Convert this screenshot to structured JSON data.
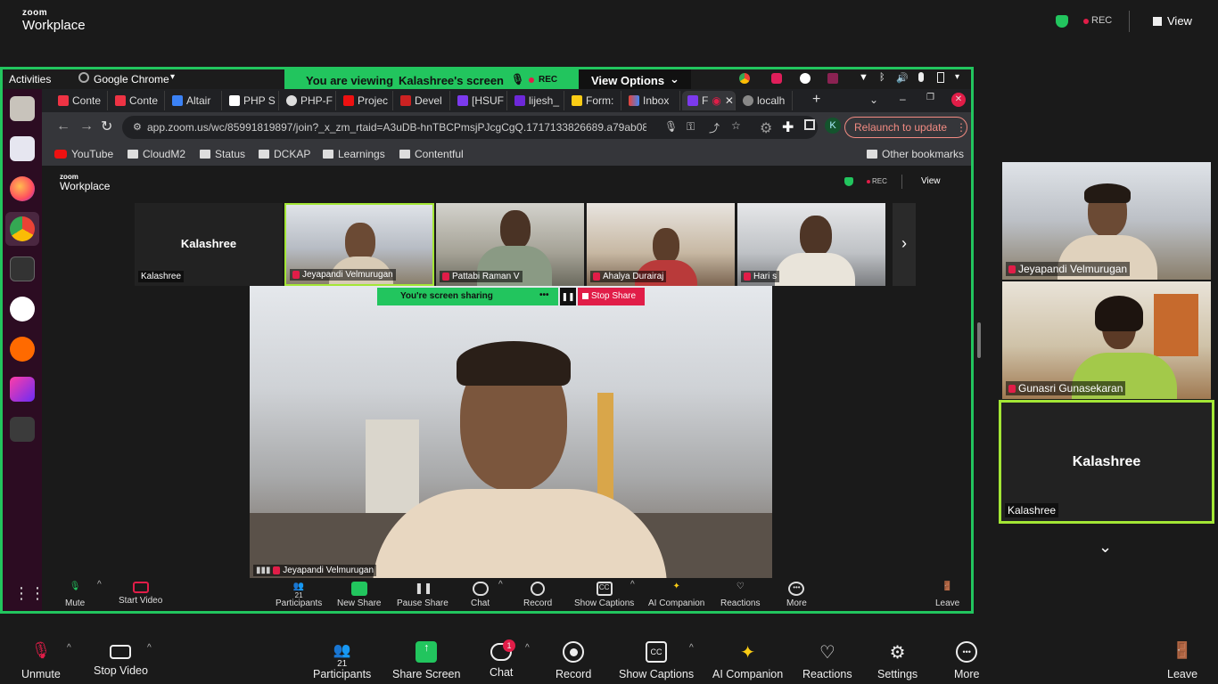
{
  "app": {
    "brand_small": "zoom",
    "brand_large": "Workplace",
    "rec_label": "REC",
    "view_label": "View"
  },
  "ubuntu": {
    "activities": "Activities",
    "app_name": "Google Chrome"
  },
  "banner": {
    "viewing_prefix": "You are viewing",
    "viewing_name": "Kalashree's screen",
    "rec": "REC",
    "view_options": "View Options"
  },
  "chrome": {
    "tabs": [
      "Conte",
      "Conte",
      "Altair",
      "PHP S",
      "PHP-F",
      "Projec",
      "Devel",
      "[HSUF",
      "lijesh_",
      "Form:",
      "Inbox",
      "F",
      "localh"
    ],
    "url": "app.zoom.us/wc/85991819897/join?_x_zm_rtaid=A3uDB-hnTBCPmsjPJcgCgQ.1717133826689.a79ab08478bd...",
    "relaunch": "Relaunch to update",
    "profile_initial": "K",
    "bookmarks": [
      "YouTube",
      "CloudM2",
      "Status",
      "DCKAP",
      "Learnings",
      "Contentful"
    ],
    "other_bookmarks": "Other bookmarks"
  },
  "inner": {
    "brand_small": "zoom",
    "brand_large": "Workplace",
    "rec": "REC",
    "view": "View",
    "strip": [
      {
        "name": "Kalashree",
        "label": "Kalashree"
      },
      {
        "label": "Jeyapandi Velmurugan"
      },
      {
        "label": "Pattabi Raman V"
      },
      {
        "label": "Ahalya Durairaj"
      },
      {
        "label": "Hari s"
      }
    ],
    "sharing_text": "You're screen sharing",
    "sharing_more": "•••",
    "stop_share": "Stop Share",
    "main_name": "Jeyapandi Velmurugan",
    "controls": {
      "mute": "Mute",
      "start_video": "Start Video",
      "participants": "Participants",
      "participants_count": "21",
      "new_share": "New Share",
      "pause_share": "Pause Share",
      "chat": "Chat",
      "record": "Record",
      "captions": "Show Captions",
      "ai": "AI Companion",
      "reactions": "Reactions",
      "more": "More",
      "leave": "Leave"
    }
  },
  "right": {
    "tiles": [
      {
        "label": "Jeyapandi Velmurugan"
      },
      {
        "label": "Gunasri Gunasekaran"
      },
      {
        "name": "Kalashree",
        "label": "Kalashree"
      }
    ]
  },
  "bottom": {
    "unmute": "Unmute",
    "stop_video": "Stop Video",
    "participants": "Participants",
    "participants_count": "21",
    "share_screen": "Share Screen",
    "chat": "Chat",
    "chat_badge": "1",
    "record": "Record",
    "captions": "Show Captions",
    "ai": "AI Companion",
    "reactions": "Reactions",
    "settings": "Settings",
    "more": "More",
    "leave": "Leave"
  },
  "colors": {
    "accent_green": "#22c55e",
    "rec_red": "#e11d48",
    "leave_red": "#e11d48"
  }
}
